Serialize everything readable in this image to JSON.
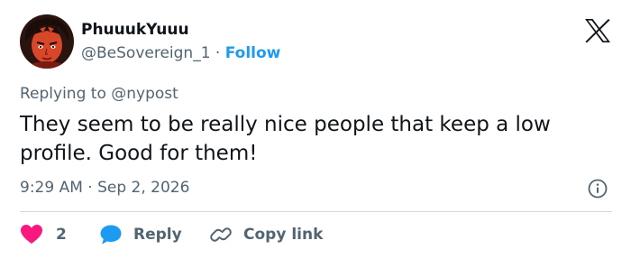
{
  "user": {
    "name": "PhuuukYuuu",
    "handle": "@BeSovereign_1",
    "separator": "·",
    "follow_label": "Follow"
  },
  "reply_context": {
    "prefix": "Replying to",
    "mention": "@nypost"
  },
  "tweet": {
    "text": "They seem to be really nice people that keep a low profile. Good for them!"
  },
  "meta": {
    "time": "9:29 AM",
    "separator": "·",
    "date": "Sep 2, 2026"
  },
  "actions": {
    "like_count": "2",
    "reply_label": "Reply",
    "copy_link_label": "Copy link"
  },
  "colors": {
    "like": "#f91880",
    "reply_bubble": "#1d9bf0",
    "follow": "#1d9bf0",
    "muted": "#536471",
    "text": "#0f1419"
  },
  "icons": [
    "x-logo-icon",
    "heart-icon",
    "reply-bubble-icon",
    "link-icon",
    "info-icon"
  ]
}
